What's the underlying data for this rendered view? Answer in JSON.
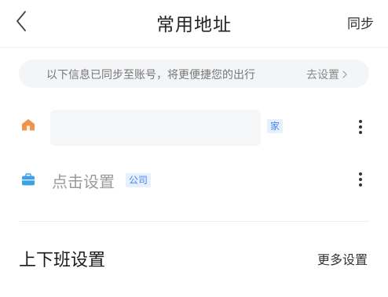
{
  "header": {
    "back_icon": "chevron-left-icon",
    "title": "常用地址",
    "sync_label": "同步"
  },
  "notice": {
    "text": "以下信息已同步至账号，将更便捷您的出行",
    "link_label": "去设置",
    "link_icon": "chevron-right-icon"
  },
  "addresses": {
    "home": {
      "icon": "home-icon",
      "icon_color": "#f0944a",
      "value": "",
      "tag": "家",
      "more_icon": "more-vertical-icon"
    },
    "company": {
      "icon": "briefcase-icon",
      "icon_color": "#3ea0e6",
      "placeholder": "点击设置",
      "tag": "公司",
      "more_icon": "more-vertical-icon"
    }
  },
  "commute": {
    "title": "上下班设置",
    "more_label": "更多设置"
  },
  "colors": {
    "accent_tag_bg": "#e7f0ff",
    "accent_tag_text": "#4a86e8"
  }
}
